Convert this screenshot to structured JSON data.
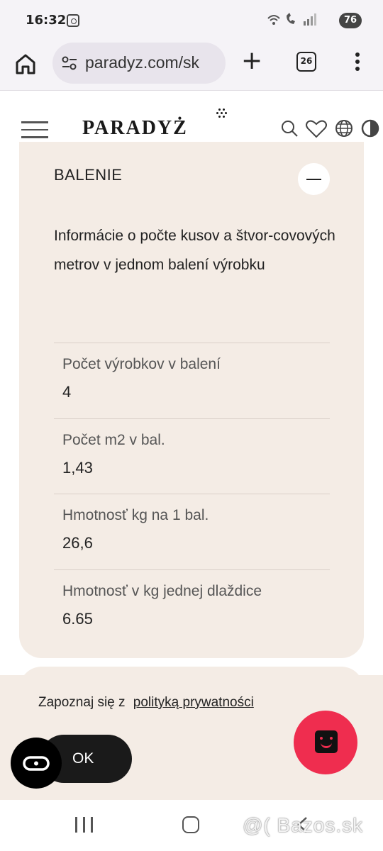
{
  "status_bar": {
    "time": "16:32",
    "battery": "76",
    "icons": [
      "screen-record-icon",
      "wifi-icon",
      "call-icon",
      "signal-icon"
    ]
  },
  "browser": {
    "url": "paradyz.com/sk",
    "tab_count": "26"
  },
  "site": {
    "logo": "PARADYŻ"
  },
  "section": {
    "title": "BALENIE",
    "description": "Informácie o počte kusov a štvor-covových metrov v jednom balení výrobku",
    "specs": [
      {
        "label": "Počet výrobkov v balení",
        "value": "4"
      },
      {
        "label": "Počet m2 v bal.",
        "value": "1,43"
      },
      {
        "label": "Hmotnosť kg na 1 bal.",
        "value": "26,6"
      },
      {
        "label": "Hmotnosť v kg jednej dlaždice",
        "value": "6.65"
      }
    ]
  },
  "cookie": {
    "text": "Zapoznaj się z",
    "link": "polityką prywatności",
    "ok": "OK"
  },
  "watermark": "@( Bazos.sk",
  "colors": {
    "card_bg": "#f4ece5",
    "chat_fab": "#ef2d4f",
    "ok_bg": "#1a1a1a"
  }
}
